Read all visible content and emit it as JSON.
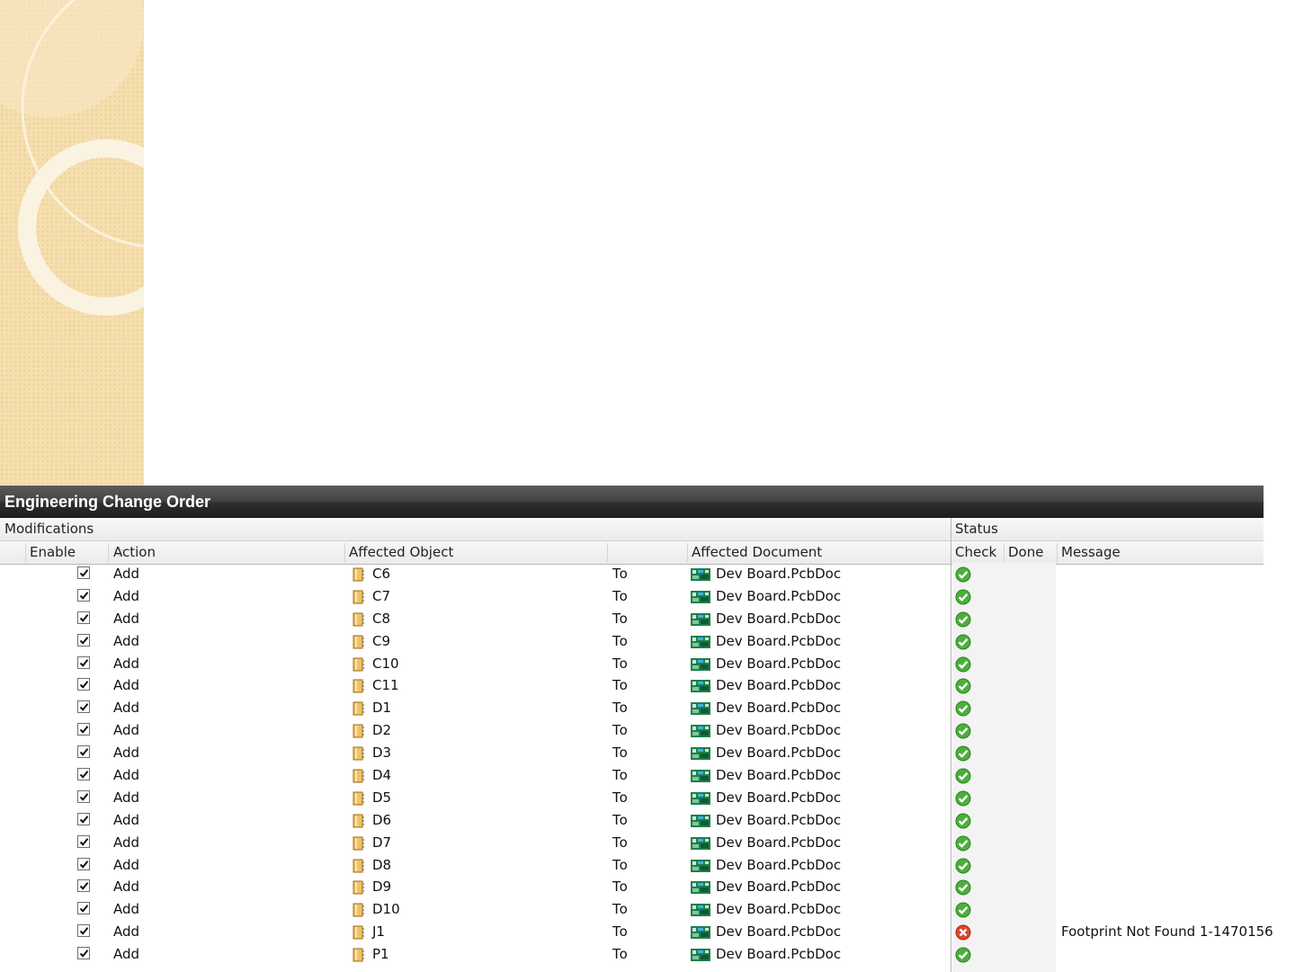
{
  "window": {
    "title": "Engineering Change Order"
  },
  "groups": {
    "modifications": "Modifications",
    "status": "Status"
  },
  "columns": {
    "enable": "Enable",
    "action": "Action",
    "affected_object": "Affected Object",
    "affected_document": "Affected Document",
    "check": "Check",
    "done": "Done",
    "message": "Message"
  },
  "rows": [
    {
      "enabled": true,
      "action": "Add",
      "object": "C6",
      "to": "To",
      "document": "Dev Board.PcbDoc",
      "check": "ok",
      "message": ""
    },
    {
      "enabled": true,
      "action": "Add",
      "object": "C7",
      "to": "To",
      "document": "Dev Board.PcbDoc",
      "check": "ok",
      "message": ""
    },
    {
      "enabled": true,
      "action": "Add",
      "object": "C8",
      "to": "To",
      "document": "Dev Board.PcbDoc",
      "check": "ok",
      "message": ""
    },
    {
      "enabled": true,
      "action": "Add",
      "object": "C9",
      "to": "To",
      "document": "Dev Board.PcbDoc",
      "check": "ok",
      "message": ""
    },
    {
      "enabled": true,
      "action": "Add",
      "object": "C10",
      "to": "To",
      "document": "Dev Board.PcbDoc",
      "check": "ok",
      "message": ""
    },
    {
      "enabled": true,
      "action": "Add",
      "object": "C11",
      "to": "To",
      "document": "Dev Board.PcbDoc",
      "check": "ok",
      "message": ""
    },
    {
      "enabled": true,
      "action": "Add",
      "object": "D1",
      "to": "To",
      "document": "Dev Board.PcbDoc",
      "check": "ok",
      "message": ""
    },
    {
      "enabled": true,
      "action": "Add",
      "object": "D2",
      "to": "To",
      "document": "Dev Board.PcbDoc",
      "check": "ok",
      "message": ""
    },
    {
      "enabled": true,
      "action": "Add",
      "object": "D3",
      "to": "To",
      "document": "Dev Board.PcbDoc",
      "check": "ok",
      "message": ""
    },
    {
      "enabled": true,
      "action": "Add",
      "object": "D4",
      "to": "To",
      "document": "Dev Board.PcbDoc",
      "check": "ok",
      "message": ""
    },
    {
      "enabled": true,
      "action": "Add",
      "object": "D5",
      "to": "To",
      "document": "Dev Board.PcbDoc",
      "check": "ok",
      "message": ""
    },
    {
      "enabled": true,
      "action": "Add",
      "object": "D6",
      "to": "To",
      "document": "Dev Board.PcbDoc",
      "check": "ok",
      "message": ""
    },
    {
      "enabled": true,
      "action": "Add",
      "object": "D7",
      "to": "To",
      "document": "Dev Board.PcbDoc",
      "check": "ok",
      "message": ""
    },
    {
      "enabled": true,
      "action": "Add",
      "object": "D8",
      "to": "To",
      "document": "Dev Board.PcbDoc",
      "check": "ok",
      "message": ""
    },
    {
      "enabled": true,
      "action": "Add",
      "object": "D9",
      "to": "To",
      "document": "Dev Board.PcbDoc",
      "check": "ok",
      "message": ""
    },
    {
      "enabled": true,
      "action": "Add",
      "object": "D10",
      "to": "To",
      "document": "Dev Board.PcbDoc",
      "check": "ok",
      "message": ""
    },
    {
      "enabled": true,
      "action": "Add",
      "object": "J1",
      "to": "To",
      "document": "Dev Board.PcbDoc",
      "check": "error",
      "message": "Footprint Not Found 1-1470156"
    },
    {
      "enabled": true,
      "action": "Add",
      "object": "P1",
      "to": "To",
      "document": "Dev Board.PcbDoc",
      "check": "ok",
      "message": ""
    }
  ],
  "icons": {
    "object": "component-icon",
    "document": "pcb-document-icon",
    "check_ok": "green-check-icon",
    "check_error": "red-x-icon",
    "sort": "sort-indicator-icon"
  },
  "colors": {
    "ok": "#4caf3c",
    "error": "#e0442a",
    "titlebar": "#2a2a2a",
    "deco_bg": "#f5dfae"
  }
}
